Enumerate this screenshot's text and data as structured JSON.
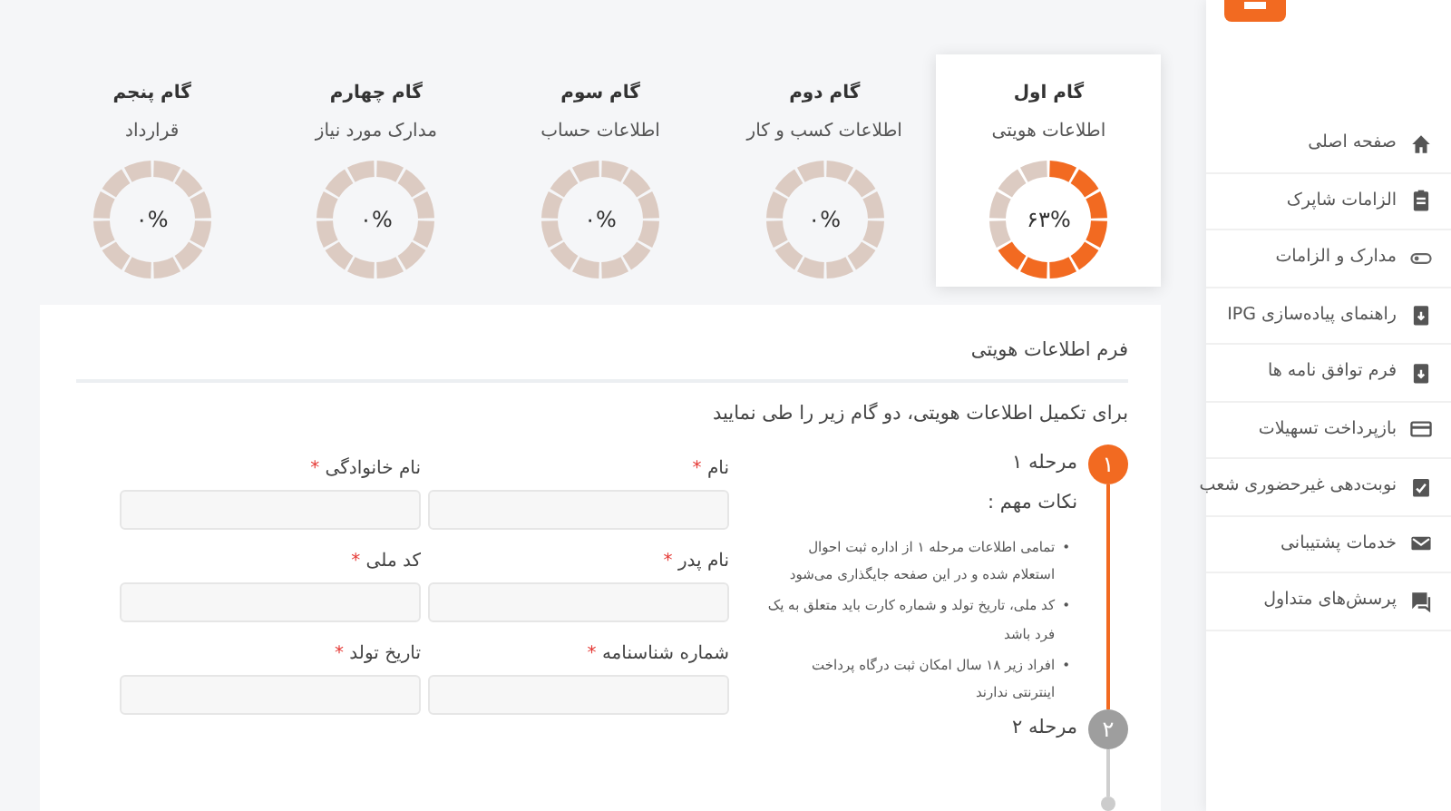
{
  "sidebar": {
    "items": [
      {
        "label": "صفحه اصلی"
      },
      {
        "label": "الزامات شاپرک"
      },
      {
        "label": "مدارک و الزامات"
      },
      {
        "label": "راهنمای پیاده‌سازی IPG"
      },
      {
        "label": "فرم توافق نامه ها"
      },
      {
        "label": "بازپرداخت تسهیلات"
      },
      {
        "label": "نوبت‌دهی غیرحضوری شعب"
      },
      {
        "label": "خدمات پشتیبانی"
      },
      {
        "label": "پرسش‌های متداول"
      }
    ]
  },
  "steps": [
    {
      "title": "گام اول",
      "subtitle": "اطلاعات هویتی",
      "percent": "۶۳%",
      "selected": true
    },
    {
      "title": "گام دوم",
      "subtitle": "اطلاعات کسب و کار",
      "percent": "۰%",
      "selected": false
    },
    {
      "title": "گام سوم",
      "subtitle": "اطلاعات حساب",
      "percent": "۰%",
      "selected": false
    },
    {
      "title": "گام چهارم",
      "subtitle": "مدارک مورد نیاز",
      "percent": "۰%",
      "selected": false
    },
    {
      "title": "گام پنجم",
      "subtitle": "قرارداد",
      "percent": "۰%",
      "selected": false
    }
  ],
  "form": {
    "title": "فرم اطلاعات هویتی",
    "instruction": "برای تکمیل اطلاعات هویتی، دو گام زیر را طی نمایید",
    "stages": [
      {
        "number": "۱",
        "label": "مرحله ۱",
        "active": true,
        "notes_title": "نکات مهم :",
        "notes": [
          {
            "marker": "•",
            "text": "تمامی اطلاعات مرحله ۱ از اداره ثبت احوال استعلام شده و در این صفحه جایگذاری می‌شود"
          },
          {
            "marker": "•",
            "text": "کد ملی، تاریخ تولد و شماره کارت باید متعلق به یک فرد باشد"
          },
          {
            "marker": "•",
            "text": "افراد زیر ۱۸ سال امکان ثبت درگاه پرداخت اینترنتی ندارند"
          }
        ]
      },
      {
        "number": "۲",
        "label": "مرحله ۲",
        "active": false
      }
    ],
    "fields": [
      {
        "label": "نام",
        "required_mark": "*"
      },
      {
        "label": "نام خانوادگی",
        "required_mark": "*"
      },
      {
        "label": "نام پدر",
        "required_mark": "*"
      },
      {
        "label": "کد ملی",
        "required_mark": "*"
      },
      {
        "label": "شماره شناسنامه",
        "required_mark": "*"
      },
      {
        "label": "تاریخ تولد",
        "required_mark": "*"
      }
    ]
  }
}
